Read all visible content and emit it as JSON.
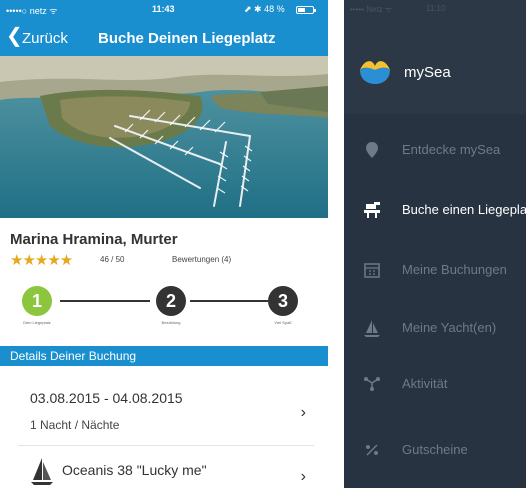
{
  "left_screen": {
    "status_bar": {
      "carrier": "•••••○ netz ᯤ",
      "time": "11:43",
      "battery_text": "⬈ ✱ 48 %",
      "battery_level": 0.48
    },
    "nav": {
      "back_label": "Zurück",
      "title": "Buche Deinen Liegeplatz"
    },
    "marina": {
      "name": "Marina Hramina, Murter",
      "stars": "★★★★★",
      "rating": "46 / 50",
      "reviews": "Bewertungen (4)"
    },
    "steps": [
      {
        "number": "1",
        "label": "Dein Liegeplatz",
        "color": "#8cc63f"
      },
      {
        "number": "2",
        "label": "Bezahlung",
        "color": "#333333"
      },
      {
        "number": "3",
        "label": "Viel Spaß",
        "color": "#333333"
      }
    ],
    "section_title": "Details Deiner Buchung",
    "booking": {
      "dates": "03.08.2015 - 04.08.2015",
      "nights": "1 Nacht / Nächte",
      "yacht": "Oceanis 38 \"Lucky me\""
    }
  },
  "right_screen": {
    "status_bar": {
      "carrier": "•••••  Netz  ᯤ",
      "time": "11:10"
    },
    "app_name": "mySea",
    "menu": [
      {
        "label": "Entdecke mySea",
        "icon": "map-pin-icon",
        "active": false
      },
      {
        "label": "Buche einen Liegeplatz",
        "icon": "dock-icon",
        "active": true
      },
      {
        "label": "Meine Buchungen",
        "icon": "calendar-icon",
        "active": false
      },
      {
        "label": "Meine Yacht(en)",
        "icon": "sailboat-icon",
        "active": false
      },
      {
        "label": "Aktivität",
        "icon": "activity-icon",
        "active": false
      },
      {
        "label": "Gutscheine",
        "icon": "percent-icon",
        "active": false
      }
    ]
  },
  "colors": {
    "primary_blue": "#1a8fd0",
    "step_active_green": "#8cc63f",
    "menu_bg": "#273340",
    "star_gold": "#e8a81e"
  }
}
